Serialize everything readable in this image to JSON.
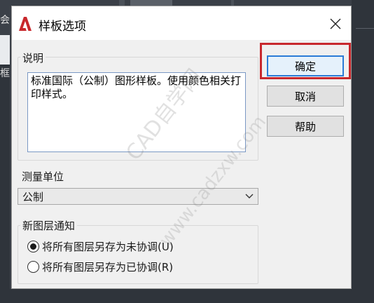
{
  "background": {
    "left_text_1": "会",
    "left_text_2": "框"
  },
  "dialog": {
    "title": "样板选项",
    "close_glyph": "✕",
    "description": {
      "label": "说明",
      "text": "标准国际（公制）图形样板。使用颜色相关打印样式。"
    },
    "measurement": {
      "label": "测量单位",
      "selected": "公制"
    },
    "new_layer_notification": {
      "label": "新图层通知",
      "options": [
        {
          "label": "将所有图层另存为未协调(U)",
          "checked": true
        },
        {
          "label": "将所有图层另存为已协调(R)",
          "checked": false
        }
      ]
    },
    "buttons": {
      "ok": "确定",
      "cancel": "取消",
      "help": "帮助"
    }
  },
  "watermark": {
    "line1": "CAD自学网",
    "line2": "www.cadzxw.com"
  },
  "colors": {
    "highlight": "#c8282d",
    "app_icon": "#c8282d",
    "default_button_border": "#2b7bd6"
  }
}
